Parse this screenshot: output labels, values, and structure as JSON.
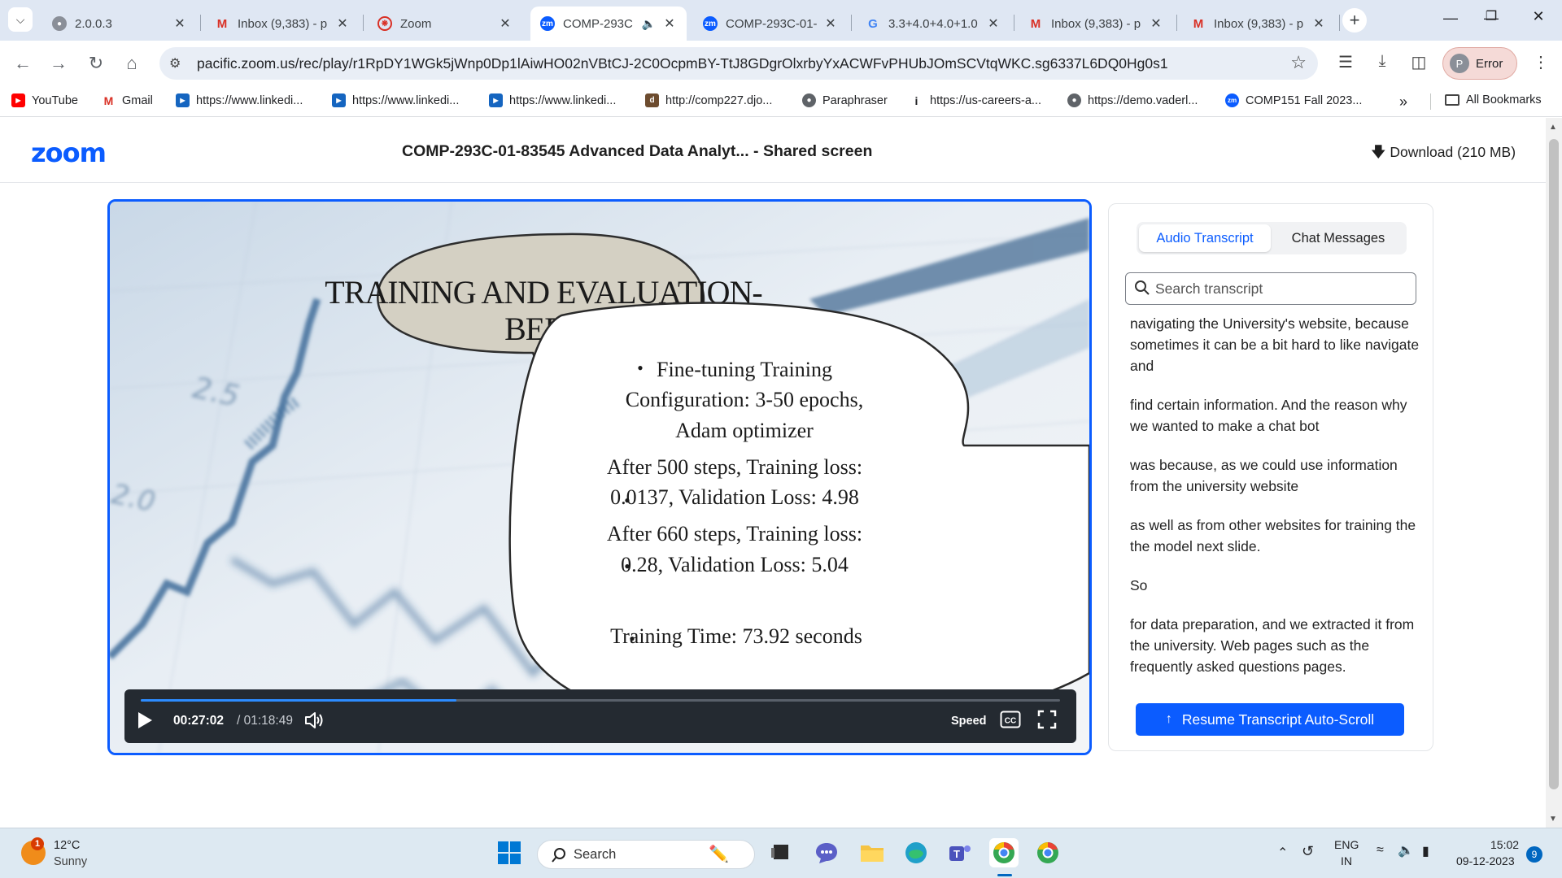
{
  "browser": {
    "tabs": [
      {
        "title": "2.0.0.3",
        "favicon": "globe-icon"
      },
      {
        "title": "Inbox (9,383) - p",
        "favicon": "gmail-icon"
      },
      {
        "title": "Zoom",
        "favicon": "zoom-gear-icon"
      },
      {
        "title": "COMP-293C",
        "favicon": "zoom-icon",
        "active": true,
        "audio": true
      },
      {
        "title": "COMP-293C-01-",
        "favicon": "zoom-icon"
      },
      {
        "title": "3.3+4.0+4.0+1.0",
        "favicon": "google-icon"
      },
      {
        "title": "Inbox (9,383) - p",
        "favicon": "gmail-icon"
      },
      {
        "title": "Inbox (9,383) - p",
        "favicon": "gmail-icon"
      }
    ],
    "url": "pacific.zoom.us/rec/play/r1RpDY1WGk5jWnp0Dp1lAiwHO02nVBtCJ-2C0OcpmBY-TtJ8GDgrOlxrbyYxACWFvPHUbJOmSCVtqWKC.sg6337L6DQ0Hg0s1",
    "profile_label": "Error",
    "profile_initial": "P",
    "bookmarks": [
      {
        "label": "YouTube",
        "icon": "youtube-icon"
      },
      {
        "label": "Gmail",
        "icon": "gmail-icon"
      },
      {
        "label": "https://www.linkedi...",
        "icon": "video-icon"
      },
      {
        "label": "https://www.linkedi...",
        "icon": "video-icon"
      },
      {
        "label": "https://www.linkedi...",
        "icon": "video-icon"
      },
      {
        "label": "http://comp227.djo...",
        "icon": "django-icon"
      },
      {
        "label": "Paraphraser",
        "icon": "globe-icon"
      },
      {
        "label": "https://us-careers-a...",
        "icon": "info-icon"
      },
      {
        "label": "https://demo.vaderl...",
        "icon": "globe-icon"
      },
      {
        "label": "COMP151 Fall 2023...",
        "icon": "zoom-icon"
      }
    ],
    "all_bookmarks_label": "All Bookmarks",
    "more_label": "»"
  },
  "zoom": {
    "logo": "zoom",
    "recording_title": "COMP-293C-01-83545 Advanced Data Analyt... - Shared screen",
    "download_label": "Download (210 MB)"
  },
  "slide": {
    "title_line1": "TRAINING AND EVALUATION-",
    "title_line2": "BERT",
    "bullets": [
      [
        "Fine-tuning Training",
        "Configuration: 3-50 epochs,",
        "Adam optimizer"
      ],
      [
        "After 500 steps, Training loss:",
        "0.0137, Validation Loss: 4.98"
      ],
      [
        "After 660 steps, Training loss:",
        "0.28, Validation Loss: 5.04"
      ],
      [
        "Training Time: 73.92 seconds"
      ]
    ],
    "background_chart_labels": [
      "2.5",
      "2.0"
    ]
  },
  "player": {
    "current_time": "00:27:02",
    "total_time": "/ 01:18:49",
    "progress_fraction": 0.343,
    "speed_label": "Speed"
  },
  "transcript_panel": {
    "tab_audio": "Audio Transcript",
    "tab_chat": "Chat Messages",
    "search_placeholder": "Search transcript",
    "segments": [
      "navigating the University's website, because sometimes it can be a bit hard to like navigate and",
      "find certain information. And the reason why we wanted to make a chat bot",
      "was because, as we could use information from the university website",
      "as well as from other websites for training the the model next slide.",
      "So",
      "for data preparation, and we extracted it from the university. Web pages such as the frequently asked questions pages."
    ],
    "resume_label": "Resume Transcript Auto-Scroll"
  },
  "taskbar": {
    "weather_temp": "12°C",
    "weather_condition": "Sunny",
    "weather_badge": "1",
    "search_label": "Search",
    "lang_line1": "ENG",
    "lang_line2": "IN",
    "time": "15:02",
    "date": "09-12-2023",
    "notification_count": "9"
  },
  "colors": {
    "zoom_blue": "#0b5cff",
    "tabstrip": "#dfe7f3",
    "taskbar": "#dde9f2"
  }
}
